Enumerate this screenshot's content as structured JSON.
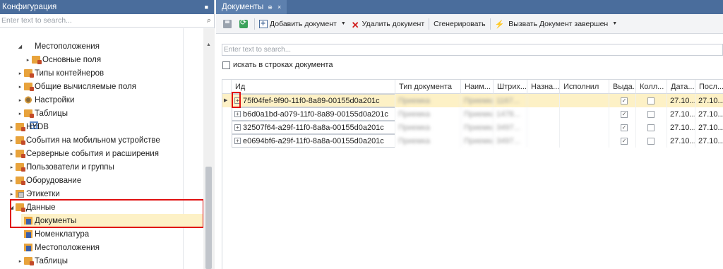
{
  "left_panel": {
    "title": "Конфигурация",
    "pin_icon": "pin-icon",
    "search_placeholder": "Enter text to search...",
    "tree": [
      {
        "label": "Местоположения",
        "icon": "grid-icon",
        "toggle": "◢"
      },
      {
        "label": "Основные поля",
        "icon": "folder-icon",
        "toggle": "▸"
      },
      {
        "label": "Типы контейнеров",
        "icon": "folder-icon",
        "toggle": "▸"
      },
      {
        "label": "Общие вычисляемые поля",
        "icon": "folder-icon",
        "toggle": "▸"
      },
      {
        "label": "Настройки",
        "icon": "gear-icon",
        "toggle": "▸"
      },
      {
        "label": "Таблицы",
        "icon": "folder-icon",
        "toggle": "▸"
      },
      {
        "label": "HYDB",
        "icon": "folder-icon",
        "toggle": "▸"
      },
      {
        "label": "События на мобильном устройстве",
        "icon": "folder-icon",
        "toggle": "▸"
      },
      {
        "label": "Серверные события и расширения",
        "icon": "folder-icon",
        "toggle": "▸"
      },
      {
        "label": "Пользователи и группы",
        "icon": "folder-icon",
        "toggle": "▸"
      },
      {
        "label": "Оборудование",
        "icon": "folder-icon",
        "toggle": "▸"
      },
      {
        "label": "Этикетки",
        "icon": "tag-icon",
        "toggle": "▸"
      },
      {
        "label": "Данные",
        "icon": "folder-icon",
        "toggle": "◢"
      },
      {
        "label": "Документы",
        "icon": "doc-icon",
        "toggle": ""
      },
      {
        "label": "Номенклатура",
        "icon": "doc-icon",
        "toggle": ""
      },
      {
        "label": "Местоположения",
        "icon": "doc-icon",
        "toggle": ""
      },
      {
        "label": "Таблицы",
        "icon": "folder-icon",
        "toggle": "▸"
      }
    ]
  },
  "right_panel": {
    "tab": {
      "label": "Документы",
      "pin": "⊕",
      "close": "×"
    },
    "toolbar": {
      "add_label": "Добавить документ",
      "delete_label": "Удалить документ",
      "generate_label": "Сгенерировать",
      "invoke_label": "Вызвать Документ завершен"
    },
    "search_placeholder": "Enter text to search...",
    "search_in_rows_label": "искать в строках документа",
    "columns": [
      "Ид",
      "Тип документа",
      "Наим...",
      "Штрих...",
      "Назна...",
      "Исполнил",
      "Выда...",
      "Колл...",
      "Дата...",
      "Посл..."
    ],
    "rows": [
      {
        "id": "75f04fef-9f90-11f0-8a89-00155d0a201c",
        "type": "Приемка",
        "name": "Приемка",
        "barcode": "1167...",
        "issued": true,
        "coll": false,
        "date": "27.10...",
        "last": "27.10..."
      },
      {
        "id": "b6d0a1bd-a079-11f0-8a89-00155d0a201c",
        "type": "Приемка",
        "name": "Приемка",
        "barcode": "1478...",
        "issued": true,
        "coll": false,
        "date": "27.10...",
        "last": "27.10..."
      },
      {
        "id": "32507f64-a29f-11f0-8a8a-00155d0a201c",
        "type": "Приемка",
        "name": "Приемка",
        "barcode": "3497...",
        "issued": true,
        "coll": false,
        "date": "27.10...",
        "last": "27.10..."
      },
      {
        "id": "e0694bf6-a29f-11f0-8a8a-00155d0a201c",
        "type": "Приемка",
        "name": "Приемка",
        "barcode": "3497...",
        "issued": true,
        "coll": false,
        "date": "27.10...",
        "last": "27.10..."
      }
    ]
  },
  "colors": {
    "header_bg": "#4a6d9c",
    "selection": "#fdf1c6",
    "highlight_red": "#e01010"
  }
}
